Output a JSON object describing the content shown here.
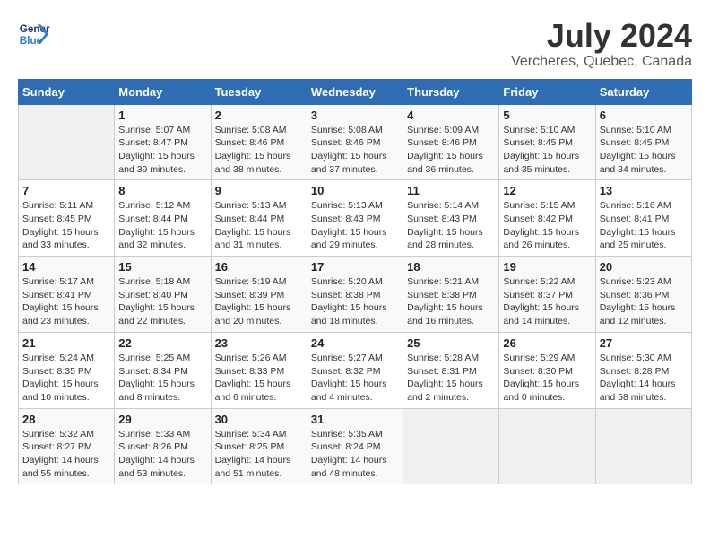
{
  "logo": {
    "line1": "General",
    "line2": "Blue"
  },
  "title": "July 2024",
  "subtitle": "Vercheres, Quebec, Canada",
  "days_of_week": [
    "Sunday",
    "Monday",
    "Tuesday",
    "Wednesday",
    "Thursday",
    "Friday",
    "Saturday"
  ],
  "weeks": [
    [
      {
        "day": "",
        "info": ""
      },
      {
        "day": "1",
        "info": "Sunrise: 5:07 AM\nSunset: 8:47 PM\nDaylight: 15 hours\nand 39 minutes."
      },
      {
        "day": "2",
        "info": "Sunrise: 5:08 AM\nSunset: 8:46 PM\nDaylight: 15 hours\nand 38 minutes."
      },
      {
        "day": "3",
        "info": "Sunrise: 5:08 AM\nSunset: 8:46 PM\nDaylight: 15 hours\nand 37 minutes."
      },
      {
        "day": "4",
        "info": "Sunrise: 5:09 AM\nSunset: 8:46 PM\nDaylight: 15 hours\nand 36 minutes."
      },
      {
        "day": "5",
        "info": "Sunrise: 5:10 AM\nSunset: 8:45 PM\nDaylight: 15 hours\nand 35 minutes."
      },
      {
        "day": "6",
        "info": "Sunrise: 5:10 AM\nSunset: 8:45 PM\nDaylight: 15 hours\nand 34 minutes."
      }
    ],
    [
      {
        "day": "7",
        "info": "Sunrise: 5:11 AM\nSunset: 8:45 PM\nDaylight: 15 hours\nand 33 minutes."
      },
      {
        "day": "8",
        "info": "Sunrise: 5:12 AM\nSunset: 8:44 PM\nDaylight: 15 hours\nand 32 minutes."
      },
      {
        "day": "9",
        "info": "Sunrise: 5:13 AM\nSunset: 8:44 PM\nDaylight: 15 hours\nand 31 minutes."
      },
      {
        "day": "10",
        "info": "Sunrise: 5:13 AM\nSunset: 8:43 PM\nDaylight: 15 hours\nand 29 minutes."
      },
      {
        "day": "11",
        "info": "Sunrise: 5:14 AM\nSunset: 8:43 PM\nDaylight: 15 hours\nand 28 minutes."
      },
      {
        "day": "12",
        "info": "Sunrise: 5:15 AM\nSunset: 8:42 PM\nDaylight: 15 hours\nand 26 minutes."
      },
      {
        "day": "13",
        "info": "Sunrise: 5:16 AM\nSunset: 8:41 PM\nDaylight: 15 hours\nand 25 minutes."
      }
    ],
    [
      {
        "day": "14",
        "info": "Sunrise: 5:17 AM\nSunset: 8:41 PM\nDaylight: 15 hours\nand 23 minutes."
      },
      {
        "day": "15",
        "info": "Sunrise: 5:18 AM\nSunset: 8:40 PM\nDaylight: 15 hours\nand 22 minutes."
      },
      {
        "day": "16",
        "info": "Sunrise: 5:19 AM\nSunset: 8:39 PM\nDaylight: 15 hours\nand 20 minutes."
      },
      {
        "day": "17",
        "info": "Sunrise: 5:20 AM\nSunset: 8:38 PM\nDaylight: 15 hours\nand 18 minutes."
      },
      {
        "day": "18",
        "info": "Sunrise: 5:21 AM\nSunset: 8:38 PM\nDaylight: 15 hours\nand 16 minutes."
      },
      {
        "day": "19",
        "info": "Sunrise: 5:22 AM\nSunset: 8:37 PM\nDaylight: 15 hours\nand 14 minutes."
      },
      {
        "day": "20",
        "info": "Sunrise: 5:23 AM\nSunset: 8:36 PM\nDaylight: 15 hours\nand 12 minutes."
      }
    ],
    [
      {
        "day": "21",
        "info": "Sunrise: 5:24 AM\nSunset: 8:35 PM\nDaylight: 15 hours\nand 10 minutes."
      },
      {
        "day": "22",
        "info": "Sunrise: 5:25 AM\nSunset: 8:34 PM\nDaylight: 15 hours\nand 8 minutes."
      },
      {
        "day": "23",
        "info": "Sunrise: 5:26 AM\nSunset: 8:33 PM\nDaylight: 15 hours\nand 6 minutes."
      },
      {
        "day": "24",
        "info": "Sunrise: 5:27 AM\nSunset: 8:32 PM\nDaylight: 15 hours\nand 4 minutes."
      },
      {
        "day": "25",
        "info": "Sunrise: 5:28 AM\nSunset: 8:31 PM\nDaylight: 15 hours\nand 2 minutes."
      },
      {
        "day": "26",
        "info": "Sunrise: 5:29 AM\nSunset: 8:30 PM\nDaylight: 15 hours\nand 0 minutes."
      },
      {
        "day": "27",
        "info": "Sunrise: 5:30 AM\nSunset: 8:28 PM\nDaylight: 14 hours\nand 58 minutes."
      }
    ],
    [
      {
        "day": "28",
        "info": "Sunrise: 5:32 AM\nSunset: 8:27 PM\nDaylight: 14 hours\nand 55 minutes."
      },
      {
        "day": "29",
        "info": "Sunrise: 5:33 AM\nSunset: 8:26 PM\nDaylight: 14 hours\nand 53 minutes."
      },
      {
        "day": "30",
        "info": "Sunrise: 5:34 AM\nSunset: 8:25 PM\nDaylight: 14 hours\nand 51 minutes."
      },
      {
        "day": "31",
        "info": "Sunrise: 5:35 AM\nSunset: 8:24 PM\nDaylight: 14 hours\nand 48 minutes."
      },
      {
        "day": "",
        "info": ""
      },
      {
        "day": "",
        "info": ""
      },
      {
        "day": "",
        "info": ""
      }
    ]
  ]
}
